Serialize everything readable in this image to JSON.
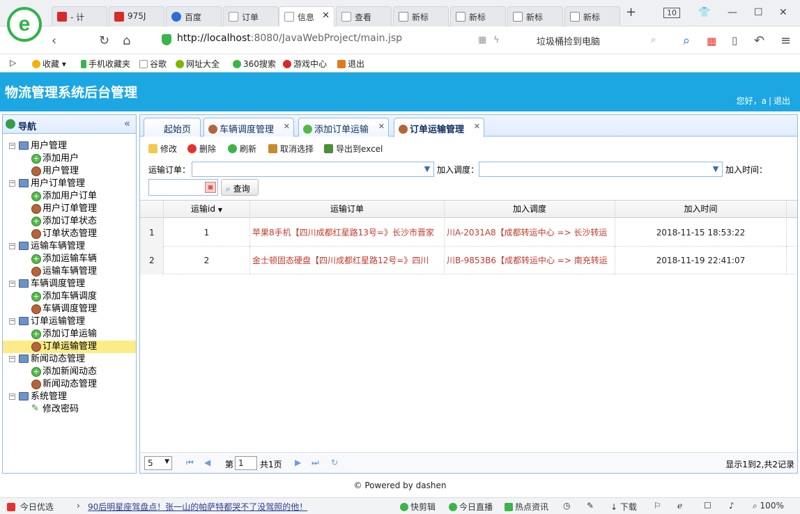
{
  "browser": {
    "tabs": [
      {
        "label": "- 计",
        "active": false,
        "color": "#d62b2b"
      },
      {
        "label": "975J",
        "active": false,
        "color": "#d62b2b"
      },
      {
        "label": "百度",
        "active": false,
        "color": "#2b6fd6"
      },
      {
        "label": "订单",
        "active": false,
        "color": "#ffffff"
      },
      {
        "label": "信息",
        "active": true,
        "color": "#ffffff"
      },
      {
        "label": "查看",
        "active": false,
        "color": "#ffffff"
      },
      {
        "label": "新标",
        "active": false,
        "color": "#888888"
      },
      {
        "label": "新标",
        "active": false,
        "color": "#888888"
      },
      {
        "label": "新标",
        "active": false,
        "color": "#888888"
      },
      {
        "label": "新标",
        "active": false,
        "color": "#888888"
      }
    ],
    "tab_count": "10",
    "url_host": "http://localhost",
    "url_rest": ":8080/JavaWebProject/main.jsp",
    "search_hint": "垃圾桶捡到电脑",
    "bookmarks": [
      "收藏",
      "手机收藏夹",
      "谷歌",
      "网址大全",
      "360搜索",
      "游戏中心",
      "退出"
    ]
  },
  "app": {
    "title": "物流管理系统后台管理",
    "greeting": "您好，a",
    "logout": "退出"
  },
  "nav": {
    "title": "导航",
    "groups": [
      {
        "label": "用户管理",
        "items": [
          {
            "label": "添加用户",
            "icon": "add"
          },
          {
            "label": "用户管理",
            "icon": "user"
          }
        ]
      },
      {
        "label": "用户订单管理",
        "items": [
          {
            "label": "添加用户订单",
            "icon": "add"
          },
          {
            "label": "用户订单管理",
            "icon": "user"
          },
          {
            "label": "添加订单状态",
            "icon": "add"
          },
          {
            "label": "订单状态管理",
            "icon": "user"
          }
        ]
      },
      {
        "label": "运输车辆管理",
        "items": [
          {
            "label": "添加运输车辆",
            "icon": "add"
          },
          {
            "label": "运输车辆管理",
            "icon": "user"
          }
        ]
      },
      {
        "label": "车辆调度管理",
        "items": [
          {
            "label": "添加车辆调度",
            "icon": "add"
          },
          {
            "label": "车辆调度管理",
            "icon": "user"
          }
        ]
      },
      {
        "label": "订单运输管理",
        "items": [
          {
            "label": "添加订单运输",
            "icon": "add"
          },
          {
            "label": "订单运输管理",
            "icon": "user",
            "selected": true
          }
        ]
      },
      {
        "label": "新闻动态管理",
        "items": [
          {
            "label": "添加新闻动态",
            "icon": "add"
          },
          {
            "label": "新闻动态管理",
            "icon": "user"
          }
        ]
      },
      {
        "label": "系统管理",
        "items": [
          {
            "label": "修改密码",
            "icon": "pen"
          }
        ]
      }
    ]
  },
  "tabs": [
    {
      "label": "起始页",
      "closable": false
    },
    {
      "label": "车辆调度管理",
      "closable": true
    },
    {
      "label": "添加订单运输",
      "closable": true
    },
    {
      "label": "订单运输管理",
      "closable": true,
      "active": true
    }
  ],
  "toolbar": {
    "edit": "修改",
    "delete": "删除",
    "refresh": "刷新",
    "unselect": "取消选择",
    "export": "导出到excel"
  },
  "filter": {
    "order_label": "运输订单：",
    "dispatch_label": "加入调度：",
    "time_label": "加入时间：",
    "query": "查询"
  },
  "grid": {
    "columns": [
      "运输id",
      "运输订单",
      "加入调度",
      "加入时间"
    ],
    "rows": [
      {
        "rownum": "1",
        "id": "1",
        "order": "苹果8手机【四川成都红星路13号=》长沙市晋家",
        "dispatch": "川A-2031A8【成都转运中心 => 长沙转运",
        "time": "2018-11-15 18:53:22"
      },
      {
        "rownum": "2",
        "id": "2",
        "order": "金士顿固态硬盘【四川成都红星路12号=》四川",
        "dispatch": "川B-9853B6【成都转运中心 => 南充转运",
        "time": "2018-11-19 22:41:07"
      }
    ]
  },
  "pager": {
    "page_size": "5",
    "page_prefix": "第",
    "page_value": "1",
    "page_suffix": "共1页",
    "info": "显示1到2,共2记录"
  },
  "footer": "© Powered by dashen",
  "statusbar": {
    "today": "今日优选",
    "news": "90后明星座驾盘点！张一山的帕萨特都哭不了没驾照的他！",
    "items": [
      "快剪辑",
      "今日直播",
      "热点资讯",
      "下载",
      "100%"
    ]
  }
}
